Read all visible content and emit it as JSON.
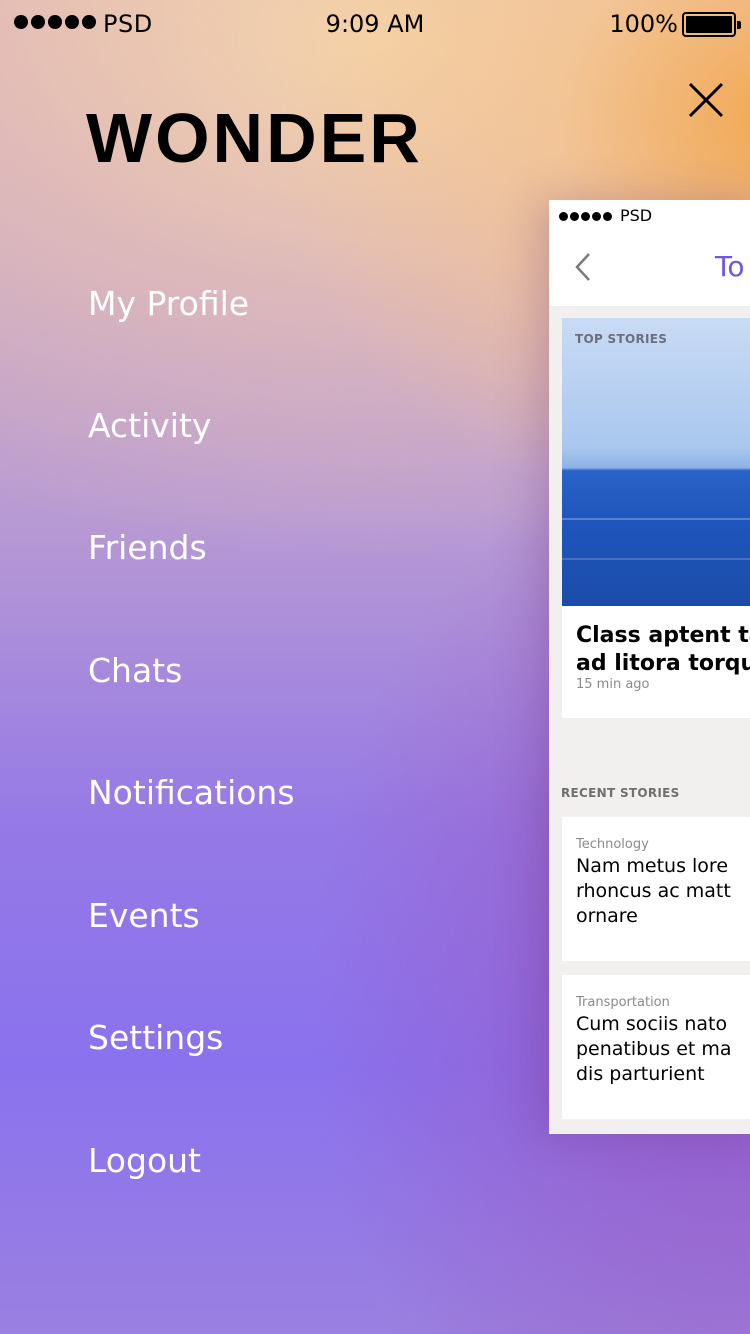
{
  "status_bar": {
    "carrier": "PSD",
    "time": "9:09 AM",
    "battery": "100%"
  },
  "brand": {
    "name": "WONDER"
  },
  "menu": {
    "items": [
      {
        "label": "My Profile"
      },
      {
        "label": "Activity"
      },
      {
        "label": "Friends"
      },
      {
        "label": "Chats"
      },
      {
        "label": "Notifications"
      },
      {
        "label": "Events"
      },
      {
        "label": "Settings"
      },
      {
        "label": "Logout"
      }
    ]
  },
  "icons": {
    "close": "close-icon",
    "back": "chevron-left-icon"
  },
  "preview": {
    "carrier": "PSD",
    "nav_title": "To",
    "featured": {
      "label": "TOP STORIES",
      "headline_line1": "Class aptent ta",
      "headline_line2": "ad litora torqu",
      "time": "15 min ago"
    },
    "section_title": "RECENT STORIES",
    "stories": [
      {
        "category": "Technology",
        "line1": "Nam metus lore",
        "line2": "rhoncus ac matt",
        "line3": "ornare"
      },
      {
        "category": "Transportation",
        "line1": "Cum sociis nato",
        "line2": "penatibus et ma",
        "line3": "dis parturient"
      }
    ]
  },
  "colors": {
    "accent": "#6e56e6",
    "menu_text": "#ffffff",
    "brand_text": "#000000"
  }
}
